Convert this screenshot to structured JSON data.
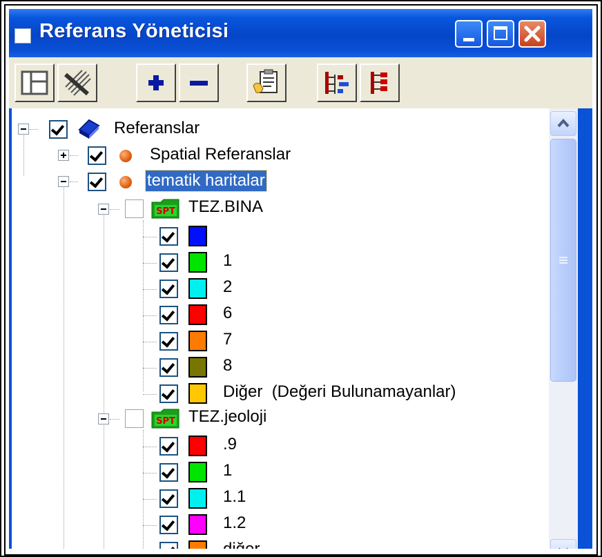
{
  "window": {
    "title": "Referans Yöneticisi",
    "controls": [
      "minimize",
      "maximize",
      "close"
    ]
  },
  "toolbar": {
    "buttons": [
      {
        "name": "layout-tool-button",
        "icon": "panel-layout-icon"
      },
      {
        "name": "remove-reference-button",
        "icon": "hatched-brush-icon"
      },
      {
        "name": "add-button",
        "icon": "plus-icon"
      },
      {
        "name": "subtract-button",
        "icon": "minus-icon"
      },
      {
        "name": "properties-button",
        "icon": "clipboard-hand-icon"
      },
      {
        "name": "expand-tree-button",
        "icon": "tree-expand-icon"
      },
      {
        "name": "collapse-tree-button",
        "icon": "tree-collapse-icon"
      }
    ]
  },
  "tree": {
    "root": {
      "label": "Referanslar",
      "checked": true,
      "expanded": true
    },
    "groups": [
      {
        "label": "Spatial Referanslar",
        "checked": true,
        "expanded": false
      },
      {
        "label": "tematik haritalar",
        "checked": true,
        "expanded": true,
        "selected": true
      }
    ],
    "layers": [
      {
        "label": "TEZ.BINA",
        "checked": false,
        "badge": "SPT",
        "items": [
          {
            "label": "",
            "color": "#0010ff"
          },
          {
            "label": "1",
            "color": "#00e400"
          },
          {
            "label": "2",
            "color": "#00f0f0"
          },
          {
            "label": "6",
            "color": "#ff0000"
          },
          {
            "label": "7",
            "color": "#ff7a00"
          },
          {
            "label": "8",
            "color": "#767600"
          },
          {
            "label": "Diğer  (Değeri Bulunamayanlar)",
            "color": "#ffc800"
          }
        ]
      },
      {
        "label": "TEZ.jeoloji",
        "checked": false,
        "badge": "SPT",
        "items": [
          {
            "label": ".9",
            "color": "#ff0000"
          },
          {
            "label": "1",
            "color": "#00e400"
          },
          {
            "label": "1.1",
            "color": "#00f0f0"
          },
          {
            "label": "1.2",
            "color": "#ff00ff"
          },
          {
            "label": "diğer",
            "color": "#ff7a00"
          }
        ]
      }
    ]
  },
  "colors": {
    "titlebar": "#0a52d6",
    "selection": "#316ac5",
    "toolbar_bg": "#ece9d8"
  }
}
